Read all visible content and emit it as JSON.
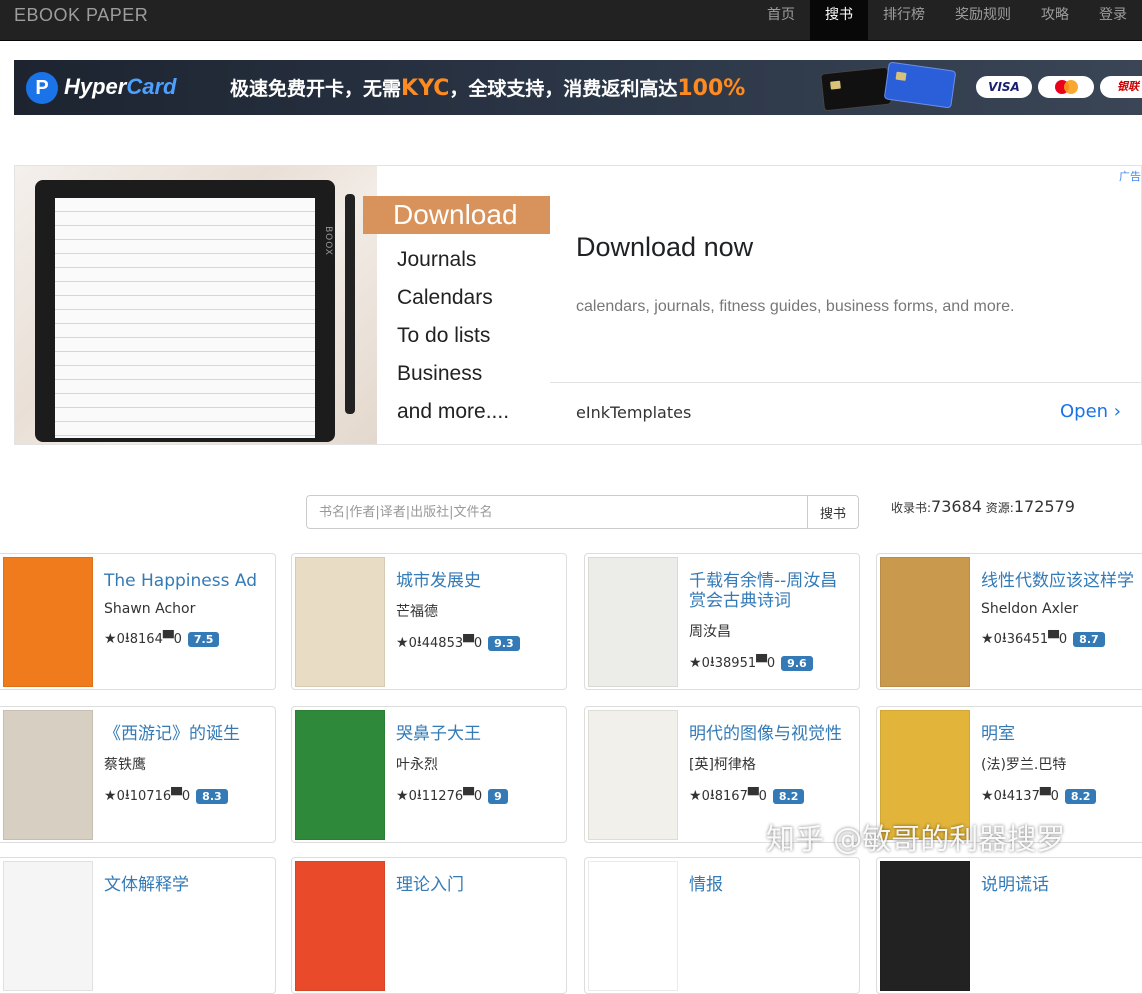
{
  "navbar": {
    "brand": "EBOOK   PAPER",
    "items": [
      "首页",
      "搜书",
      "排行榜",
      "奖励规则",
      "攻略",
      "登录"
    ],
    "active_index": 1
  },
  "hypercard_ad": {
    "logo_mark": "P",
    "logo_word1": "Hyper",
    "logo_word2": "Card",
    "slogan_a": "极速免费开卡，无需",
    "slogan_kyc": "KYC",
    "slogan_b": "，全球支持，消费返利高达",
    "slogan_pct": "100%",
    "payment_visa": "VISA",
    "payment_unionpay": "银联"
  },
  "eink_ad": {
    "download_tag": "Download",
    "menu_items": [
      "Journals",
      "Calendars",
      "To do lists",
      "Business",
      "and more...."
    ],
    "badge": "广告",
    "title": "Download now",
    "description": "calendars, journals, fitness guides, business forms, and more.",
    "host": "eInkTemplates",
    "open_label": "Open",
    "tablet_brand": "BOOX"
  },
  "search": {
    "placeholder": "书名|作者|译者|出版社|文件名",
    "value": "",
    "button_label": "搜书"
  },
  "stats": {
    "books_label": "收录书:",
    "books_count": "73684",
    "resources_label": "资源:",
    "resources_count": "172579"
  },
  "books": [
    {
      "title": "The Happiness Ad",
      "author": "Shawn Achor",
      "stars": "0",
      "downloads": "8164",
      "comments": "0",
      "rating": "7.5",
      "cover_color": "#f07b1c"
    },
    {
      "title": "城市发展史",
      "author": "芒福德",
      "stars": "0",
      "downloads": "44853",
      "comments": "0",
      "rating": "9.3",
      "cover_color": "#e8dcc4"
    },
    {
      "title": "千载有余情--周汝昌赏会古典诗词",
      "author": "周汝昌",
      "stars": "0",
      "downloads": "38951",
      "comments": "0",
      "rating": "9.6",
      "cover_color": "#ecece8"
    },
    {
      "title": "线性代数应该这样学",
      "author": "Sheldon Axler",
      "stars": "0",
      "downloads": "36451",
      "comments": "0",
      "rating": "8.7",
      "cover_color": "#c99a4e"
    },
    {
      "title": "《西游记》的诞生",
      "author": "蔡铁鹰",
      "stars": "0",
      "downloads": "10716",
      "comments": "0",
      "rating": "8.3",
      "cover_color": "#d8cfc3"
    },
    {
      "title": "哭鼻子大王",
      "author": "叶永烈",
      "stars": "0",
      "downloads": "11276",
      "comments": "0",
      "rating": "9",
      "cover_color": "#2e8a3a"
    },
    {
      "title": "明代的图像与视觉性",
      "author": "[英]柯律格",
      "stars": "0",
      "downloads": "8167",
      "comments": "0",
      "rating": "8.2",
      "cover_color": "#f2f0ea"
    },
    {
      "title": "明室",
      "author": "(法)罗兰.巴特",
      "stars": "0",
      "downloads": "4137",
      "comments": "0",
      "rating": "8.2",
      "cover_color": "#e2b53a"
    },
    {
      "title": "文体解释学",
      "author": "",
      "stars": "",
      "downloads": "",
      "comments": "",
      "rating": "",
      "cover_color": "#f5f5f5"
    },
    {
      "title": "理论入门",
      "author": "",
      "stars": "",
      "downloads": "",
      "comments": "",
      "rating": "",
      "cover_color": "#e94b2a"
    },
    {
      "title": "情报",
      "author": "",
      "stars": "",
      "downloads": "",
      "comments": "",
      "rating": "",
      "cover_color": "#ffffff"
    },
    {
      "title": "说明谎话",
      "author": "",
      "stars": "",
      "downloads": "",
      "comments": "",
      "rating": "",
      "cover_color": "#222222"
    }
  ],
  "watermark": "知乎 @敏哥的利器搜罗"
}
